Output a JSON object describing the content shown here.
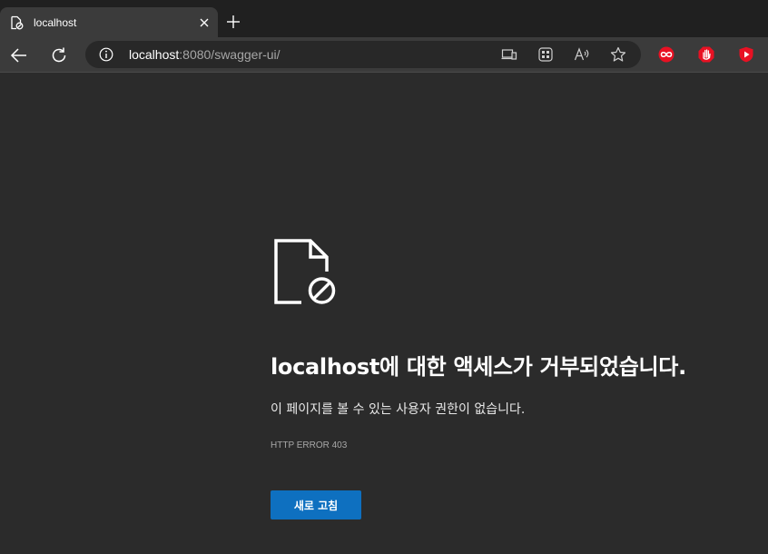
{
  "tab": {
    "title": "localhost"
  },
  "address_bar": {
    "host": "localhost",
    "rest": ":8080/swagger-ui/"
  },
  "icons": {
    "tab_favicon": "blocked-page-icon",
    "tab_close": "close-icon",
    "new_tab": "plus-icon",
    "back": "back-arrow-icon",
    "refresh": "refresh-icon",
    "site_info": "info-icon",
    "app_available": "app-install-icon",
    "collections": "collections-icon",
    "read_aloud": "read-aloud-icon",
    "favorite": "star-icon",
    "extensions": [
      "red-infinity-extension-icon",
      "red-hand-extension-icon",
      "red-play-extension-icon"
    ]
  },
  "error": {
    "heading": "localhost에 대한 액세스가 거부되었습니다.",
    "message": "이 페이지를 볼 수 있는 사용자 권한이 없습니다.",
    "code": "HTTP ERROR 403",
    "button_label": "새로 고침"
  },
  "colors": {
    "accent_button": "#0e70c0",
    "page_background": "#2b2b2b",
    "extension_red": "#e81123"
  }
}
